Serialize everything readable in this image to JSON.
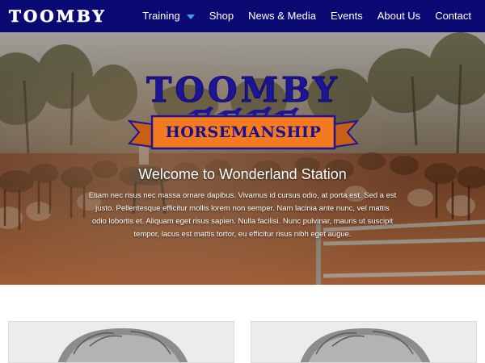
{
  "brand": {
    "name": "TOOMBY"
  },
  "nav": {
    "items": [
      {
        "label": "Training",
        "has_dropdown": true
      },
      {
        "label": "Shop"
      },
      {
        "label": "News & Media"
      },
      {
        "label": "Events"
      },
      {
        "label": "About Us"
      },
      {
        "label": "Contact"
      }
    ],
    "background": "#0b0a73",
    "dropdown_caret_color": "#3fa0e6"
  },
  "hero": {
    "logo": {
      "title": "TOOMBY",
      "subtitle": "HORSEMANSHIP",
      "title_color": "#1c1596",
      "ribbon_color": "#f47a20"
    },
    "title": "Welcome to Wonderland Station",
    "text": "Etiam nec risus nec massa ornare dapibus. Vivamus id cursus odio, at porta est. Sed a est justo. Pellentesque efficitur mollis lorem non semper. Nam lacinia ante nunc, vel mattis odio lobortis et. Aliquam eget risus sapien. Nulla facilisi. Nunc pulvinar, mauris ut suscipit tempor, lacus est mattis tortor, eu efficitur risus nibh eget augue."
  },
  "cards": [
    {
      "image": "portrait-photo"
    },
    {
      "image": "portrait-photo"
    }
  ]
}
